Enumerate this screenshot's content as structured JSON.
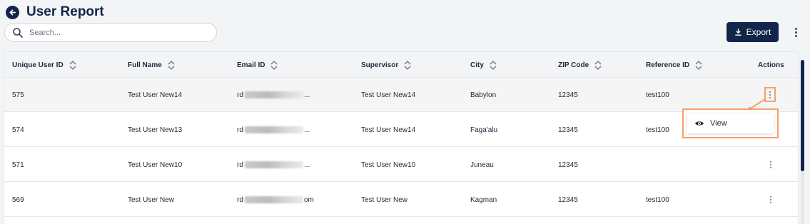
{
  "header": {
    "title": "User Report"
  },
  "search": {
    "placeholder": "Search..."
  },
  "toolbar": {
    "export_label": "Export"
  },
  "table": {
    "columns": [
      "Unique User ID",
      "Full Name",
      "Email ID",
      "Supervisor",
      "City",
      "ZIP Code",
      "Reference ID",
      "Actions"
    ],
    "rows": [
      {
        "id": "575",
        "name": "Test User New14",
        "email_prefix": "rd",
        "email_suffix": "...",
        "supervisor": "Test User New14",
        "city": "Babylon",
        "zip": "12345",
        "ref": "test100"
      },
      {
        "id": "574",
        "name": "Test User New13",
        "email_prefix": "rd",
        "email_suffix": "...",
        "supervisor": "Test User New14",
        "city": "Faga'alu",
        "zip": "12345",
        "ref": "test100"
      },
      {
        "id": "571",
        "name": "Test User New10",
        "email_prefix": "rd",
        "email_suffix": "...",
        "supervisor": "Test User New10",
        "city": "Juneau",
        "zip": "12345",
        "ref": ""
      },
      {
        "id": "569",
        "name": "Test User New",
        "email_prefix": "rd",
        "email_suffix": "om",
        "supervisor": "Test User New",
        "city": "Kagman",
        "zip": "12345",
        "ref": "test100"
      }
    ]
  },
  "menu": {
    "view_label": "View"
  },
  "colors": {
    "primary": "#12254a",
    "highlight": "#f6a06a"
  },
  "icons": [
    "back-arrow-icon",
    "search-icon",
    "download-icon",
    "more-vertical-icon",
    "sort-icon",
    "eye-icon"
  ]
}
